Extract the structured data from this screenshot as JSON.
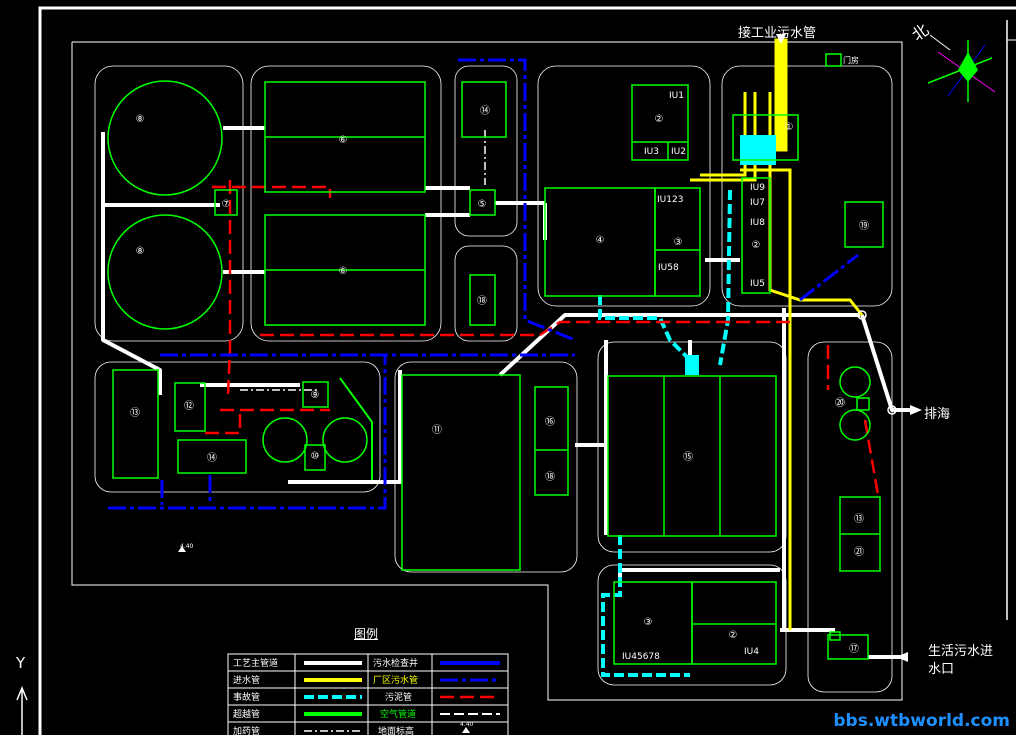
{
  "annotations": {
    "industrial_inlet": "接工业污水管",
    "sea_outfall": "排海",
    "domestic_inlet_line1": "生活污水进",
    "domestic_inlet_line2": "水口",
    "gatehouse": "门房",
    "north": "北",
    "axis_y": "Y",
    "elev_a": "4.40",
    "elev_b": "4.40"
  },
  "units": {
    "u1": "①",
    "u2": "②",
    "u3": "③",
    "u4": "④",
    "u5": "⑤",
    "u6": "⑥",
    "u7": "⑦",
    "u8": "⑧",
    "u9": "⑨",
    "u10": "⑩",
    "u11": "⑪",
    "u12": "⑫",
    "u13": "⑬",
    "u14": "⑭",
    "u15": "⑮",
    "u16": "⑯",
    "u17": "⑰",
    "u18": "⑱",
    "u19": "⑲",
    "u20": "⑳",
    "u21": "㉑"
  },
  "iu": {
    "iu1": "IU1",
    "iu2": "IU2",
    "iu3": "IU3",
    "iu4": "IU4",
    "iu5": "IU5",
    "iu7": "IU7",
    "iu8": "IU8",
    "iu9": "IU9",
    "iu58": "IU58",
    "iu123": "IU123",
    "iu45678": "IU45678"
  },
  "legend": {
    "title": "图例",
    "rows": [
      {
        "left": "工艺主管道",
        "right": "污水检查井"
      },
      {
        "left": "进水管",
        "right": "厂区污水管"
      },
      {
        "left": "事故管",
        "right": "污泥管"
      },
      {
        "left": "超越管",
        "right": "空气管道"
      },
      {
        "left": "加药管",
        "right": "地面标高"
      }
    ],
    "elev_value": "4.40"
  },
  "colors": {
    "process": "#ffffff",
    "inlet": "#ffff00",
    "accident": "#00ffff",
    "bypass": "#00ff00",
    "dosing": "#ffffff",
    "inspection": "#0000ff",
    "sewage": "#0000ff",
    "sludge": "#ff0000",
    "air": "#ffffff",
    "structure": "#00ff00"
  },
  "watermark": "bbs.wtbworld.com"
}
